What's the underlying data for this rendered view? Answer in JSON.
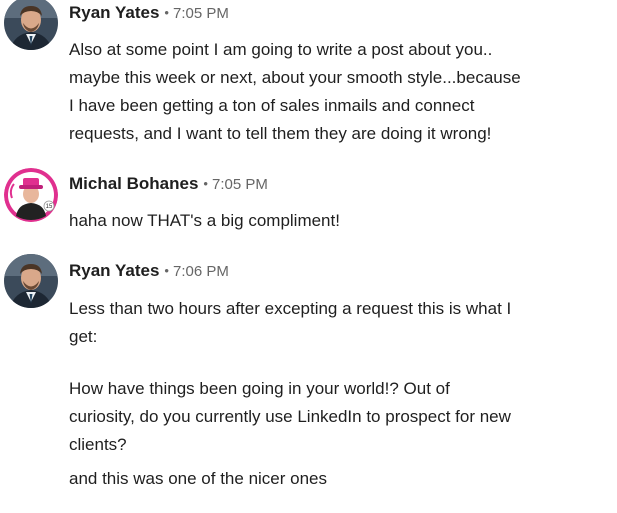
{
  "messages": [
    {
      "sender": "Ryan Yates",
      "separator": "•",
      "time": "7:05 PM",
      "lines": [
        "Also at some point I am going to write a post about you..",
        "maybe this week or next, about your smooth style...because",
        "I have been getting a ton of sales inmails and connect",
        "requests, and I want to tell them they are doing it wrong!"
      ]
    },
    {
      "sender": "Michal Bohanes",
      "separator": "•",
      "time": "7:05 PM",
      "avatar_badge": "15",
      "lines": [
        "haha now THAT's a big compliment!"
      ]
    },
    {
      "sender": "Ryan Yates",
      "separator": "•",
      "time": "7:06 PM",
      "lines": [
        "Less than two hours after excepting a request this is what I",
        "get:",
        "How have things been going in your world!? Out of",
        "curiosity, do you currently use LinkedIn to prospect for new",
        "clients?",
        "and this was one of the nicer ones"
      ]
    }
  ],
  "colors": {
    "text": "#1f1f1f",
    "meta": "#666666",
    "avatar_ring_pink": "#e0308f"
  }
}
